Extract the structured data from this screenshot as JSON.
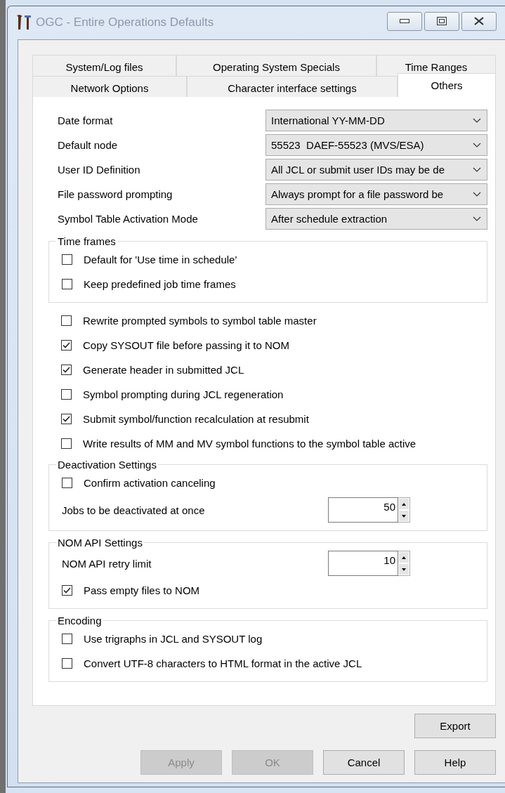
{
  "window": {
    "title": "OGC - Entire Operations Defaults"
  },
  "tab_rows": [
    [
      {
        "label": "System/Log files",
        "selected": false
      },
      {
        "label": "Operating System Specials",
        "selected": false
      },
      {
        "label": "Time Ranges",
        "selected": false
      }
    ],
    [
      {
        "label": "Network Options",
        "selected": false
      },
      {
        "label": "Character interface settings",
        "selected": false
      },
      {
        "label": "Others",
        "selected": true
      }
    ]
  ],
  "settings": [
    {
      "label": "Date format",
      "value": "International YY-MM-DD"
    },
    {
      "label": "Default node",
      "value": "55523  DAEF-55523 (MVS/ESA)"
    },
    {
      "label": "User ID Definition",
      "value": "All JCL or submit user IDs may be de"
    },
    {
      "label": "File password prompting",
      "value": "Always prompt for a file password be"
    },
    {
      "label": "Symbol Table Activation Mode",
      "value": "After schedule extraction"
    }
  ],
  "sections": [
    {
      "kind": "group",
      "title": "Time frames",
      "items": [
        {
          "kind": "checkbox",
          "label": "Default for 'Use time in schedule'",
          "checked": false
        },
        {
          "kind": "checkbox",
          "label": "Keep predefined job time frames",
          "checked": false
        }
      ]
    },
    {
      "kind": "checkbox",
      "label": "Rewrite prompted symbols to symbol table master",
      "checked": false
    },
    {
      "kind": "checkbox",
      "label": "Copy SYSOUT file before passing it to NOM",
      "checked": true
    },
    {
      "kind": "checkbox",
      "label": "Generate header in submitted JCL",
      "checked": true
    },
    {
      "kind": "checkbox",
      "label": "Symbol prompting during JCL regeneration",
      "checked": false
    },
    {
      "kind": "checkbox",
      "label": "Submit symbol/function recalculation at resubmit",
      "checked": true
    },
    {
      "kind": "checkbox",
      "label": "Write results of MM and MV symbol functions to the symbol table active",
      "checked": false
    },
    {
      "kind": "group",
      "title": "Deactivation Settings",
      "items": [
        {
          "kind": "checkbox",
          "label": "Confirm activation canceling",
          "checked": false
        },
        {
          "kind": "spinner",
          "label": "Jobs to be deactivated at once",
          "value": "50"
        }
      ]
    },
    {
      "kind": "group",
      "title": "NOM API Settings",
      "items": [
        {
          "kind": "spinner",
          "label": "NOM API retry limit",
          "value": "10"
        },
        {
          "kind": "checkbox",
          "label": "Pass empty files to NOM",
          "checked": true
        }
      ]
    },
    {
      "kind": "group",
      "title": "Encoding",
      "items": [
        {
          "kind": "checkbox",
          "label": "Use trigraphs in JCL and SYSOUT log",
          "checked": false
        },
        {
          "kind": "checkbox",
          "label": "Convert UTF-8 characters to HTML format in the active JCL",
          "checked": false
        }
      ]
    }
  ],
  "export_button": {
    "label": "Export",
    "disabled": false
  },
  "buttons": [
    {
      "label": "Apply",
      "disabled": true
    },
    {
      "label": "OK",
      "disabled": true
    },
    {
      "label": "Cancel",
      "disabled": false
    },
    {
      "label": "Help",
      "disabled": false
    }
  ]
}
